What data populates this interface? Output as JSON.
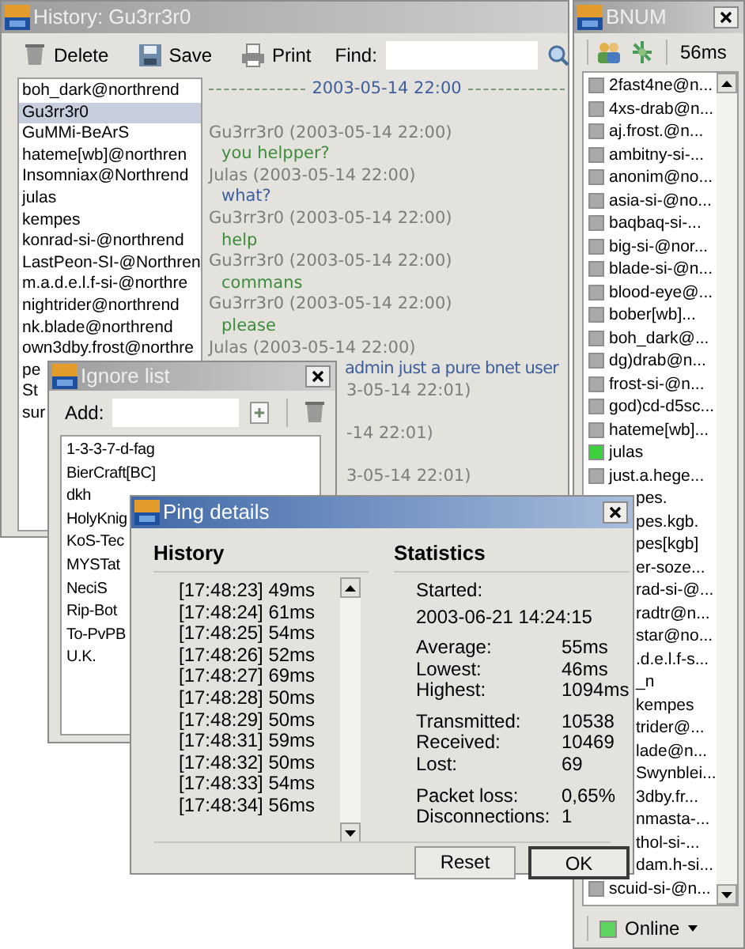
{
  "history_window": {
    "title": "History: Gu3rr3r0",
    "toolbar": [
      {
        "label": "Delete",
        "kind": "trash"
      },
      {
        "label": "Save",
        "kind": "save"
      },
      {
        "label": "Print",
        "kind": "print"
      }
    ],
    "find_label": "Find:",
    "contacts": [
      {
        "name": "boh_dark@northrend",
        "selected": false
      },
      {
        "name": "Gu3rr3r0",
        "selected": true
      },
      {
        "name": "GuMMi-BeArS",
        "selected": false
      },
      {
        "name": "hateme[wb]@northren",
        "selected": false
      },
      {
        "name": "Insomniax@Northrend",
        "selected": false
      },
      {
        "name": "julas",
        "selected": false
      },
      {
        "name": "kempes",
        "selected": false
      },
      {
        "name": "konrad-si-@northrend",
        "selected": false
      },
      {
        "name": "LastPeon-SI-@Northren",
        "selected": false
      },
      {
        "name": "m.a.d.e.l.f-si-@northre",
        "selected": false
      },
      {
        "name": "nightrider@northrend",
        "selected": false
      },
      {
        "name": "nk.blade@northrend",
        "selected": false
      },
      {
        "name": "own3dby.frost@northre",
        "selected": false
      },
      {
        "name": "pe",
        "selected": false
      },
      {
        "name": "St",
        "selected": false
      },
      {
        "name": "sur",
        "selected": false
      }
    ],
    "date_separator": "2003-05-14 22:00",
    "messages": [
      {
        "kind": "author",
        "text": "Gu3rr3r0 (2003-05-14 22:00)"
      },
      {
        "kind": "text",
        "text": "you helpper?",
        "color": "#3c8c3c"
      },
      {
        "kind": "author",
        "text": "Julas (2003-05-14 22:00)"
      },
      {
        "kind": "text",
        "text": "what?",
        "color": "#3d5f9e"
      },
      {
        "kind": "author",
        "text": "Gu3rr3r0 (2003-05-14 22:00)"
      },
      {
        "kind": "text",
        "text": "help",
        "color": "#3c8c3c"
      },
      {
        "kind": "author",
        "text": "Gu3rr3r0 (2003-05-14 22:00)"
      },
      {
        "kind": "text",
        "text": "commans",
        "color": "#3c8c3c"
      },
      {
        "kind": "author",
        "text": "Gu3rr3r0 (2003-05-14 22:00)"
      },
      {
        "kind": "text",
        "text": "please",
        "color": "#3c8c3c"
      },
      {
        "kind": "author",
        "text": "Julas (2003-05-14 22:00)"
      },
      {
        "kind": "text_cut",
        "text": "admin just a pure bnet user",
        "color": "#3d5f9e"
      },
      {
        "kind": "author_cut",
        "text": "3-05-14 22:01)"
      },
      {
        "kind": "author_cut",
        "text": "-14 22:01)"
      },
      {
        "kind": "author_cut",
        "text": "3-05-14 22:01)"
      }
    ]
  },
  "ignore_window": {
    "title": "Ignore list",
    "add_label": "Add:",
    "entries": [
      "1-3-3-7-d-fag",
      "BierCraft[BC]",
      "dkh",
      "HolyKnig",
      "KoS-Tec",
      "MYSTat",
      "NeciS",
      "Rip-Bot",
      "To-PvPB",
      "U.K."
    ]
  },
  "bnum_window": {
    "title": "BNUM",
    "ping": "56ms",
    "users": [
      {
        "kind": "full",
        "name": "2fast4ne@n...",
        "online": false
      },
      {
        "kind": "full",
        "name": "4xs-drab@n...",
        "online": false
      },
      {
        "kind": "full",
        "name": "aj.frost.@n...",
        "online": false
      },
      {
        "kind": "full",
        "name": "ambitny-si-...",
        "online": false
      },
      {
        "kind": "full",
        "name": "anonim@no...",
        "online": false
      },
      {
        "kind": "full",
        "name": "asia-si-@no...",
        "online": false
      },
      {
        "kind": "full",
        "name": "baqbaq-si-...",
        "online": false
      },
      {
        "kind": "full",
        "name": "big-si-@nor...",
        "online": false
      },
      {
        "kind": "full",
        "name": "blade-si-@n...",
        "online": false
      },
      {
        "kind": "full",
        "name": "blood-eye@...",
        "online": false
      },
      {
        "kind": "full",
        "name": "bober[wb]...",
        "online": false
      },
      {
        "kind": "full",
        "name": "boh_dark@...",
        "online": false
      },
      {
        "kind": "full",
        "name": "dg)drab@n...",
        "online": false
      },
      {
        "kind": "full",
        "name": "frost-si-@n...",
        "online": false
      },
      {
        "kind": "full",
        "name": "god)cd-d5sc...",
        "online": false
      },
      {
        "kind": "full",
        "name": "hateme[wb]...",
        "online": false
      },
      {
        "kind": "full",
        "name": "julas",
        "online": true
      },
      {
        "kind": "full",
        "name": "just.a.hege...",
        "online": false
      },
      {
        "kind": "cut",
        "name": "pes."
      },
      {
        "kind": "cut",
        "name": "pes.kgb."
      },
      {
        "kind": "cut",
        "name": "pes[kgb]"
      },
      {
        "kind": "cut",
        "name": "er-soze..."
      },
      {
        "kind": "cut",
        "name": "rad-si-@..."
      },
      {
        "kind": "cut",
        "name": "radtr@n..."
      },
      {
        "kind": "cut",
        "name": "star@no..."
      },
      {
        "kind": "cut",
        "name": ".d.e.l.f-s..."
      },
      {
        "kind": "cut",
        "name": "_n"
      },
      {
        "kind": "cut",
        "name": "kempes"
      },
      {
        "kind": "cut",
        "name": "trider@..."
      },
      {
        "kind": "cut",
        "name": "lade@n..."
      },
      {
        "kind": "cut",
        "name": "Swynblei..."
      },
      {
        "kind": "cut",
        "name": "3dby.fr..."
      },
      {
        "kind": "cut",
        "name": "nmasta-..."
      },
      {
        "kind": "cut",
        "name": "thol-si-..."
      },
      {
        "kind": "cut",
        "name": "dam.h-si..."
      },
      {
        "kind": "full",
        "name": "scuid-si-@n...",
        "online": false
      }
    ],
    "status": "Online"
  },
  "ping_window": {
    "title": "Ping details",
    "history_heading": "History",
    "history": [
      "[17:48:23] 49ms",
      "[17:48:24] 61ms",
      "[17:48:25] 54ms",
      "[17:48:26] 52ms",
      "[17:48:27] 69ms",
      "[17:48:28] 50ms",
      "[17:48:29] 50ms",
      "[17:48:31] 59ms",
      "[17:48:32] 50ms",
      "[17:48:33] 54ms",
      "[17:48:34] 56ms"
    ],
    "statistics_heading": "Statistics",
    "started_label": "Started:",
    "started_value": "2003-06-21 14:24:15",
    "stat_groups": [
      [
        {
          "label": "Average:",
          "value": "55ms"
        },
        {
          "label": "Lowest:",
          "value": "46ms"
        },
        {
          "label": "Highest:",
          "value": "1094ms"
        }
      ],
      [
        {
          "label": "Transmitted:",
          "value": "10538"
        },
        {
          "label": "Received:",
          "value": "10469"
        },
        {
          "label": "Lost:",
          "value": "69"
        }
      ],
      [
        {
          "label": "Packet loss:",
          "value": "0,65%"
        },
        {
          "label": "Disconnections:",
          "value": "1"
        }
      ]
    ],
    "buttons": [
      {
        "label": "Reset",
        "default": false
      },
      {
        "label": "OK",
        "default": true
      }
    ]
  }
}
